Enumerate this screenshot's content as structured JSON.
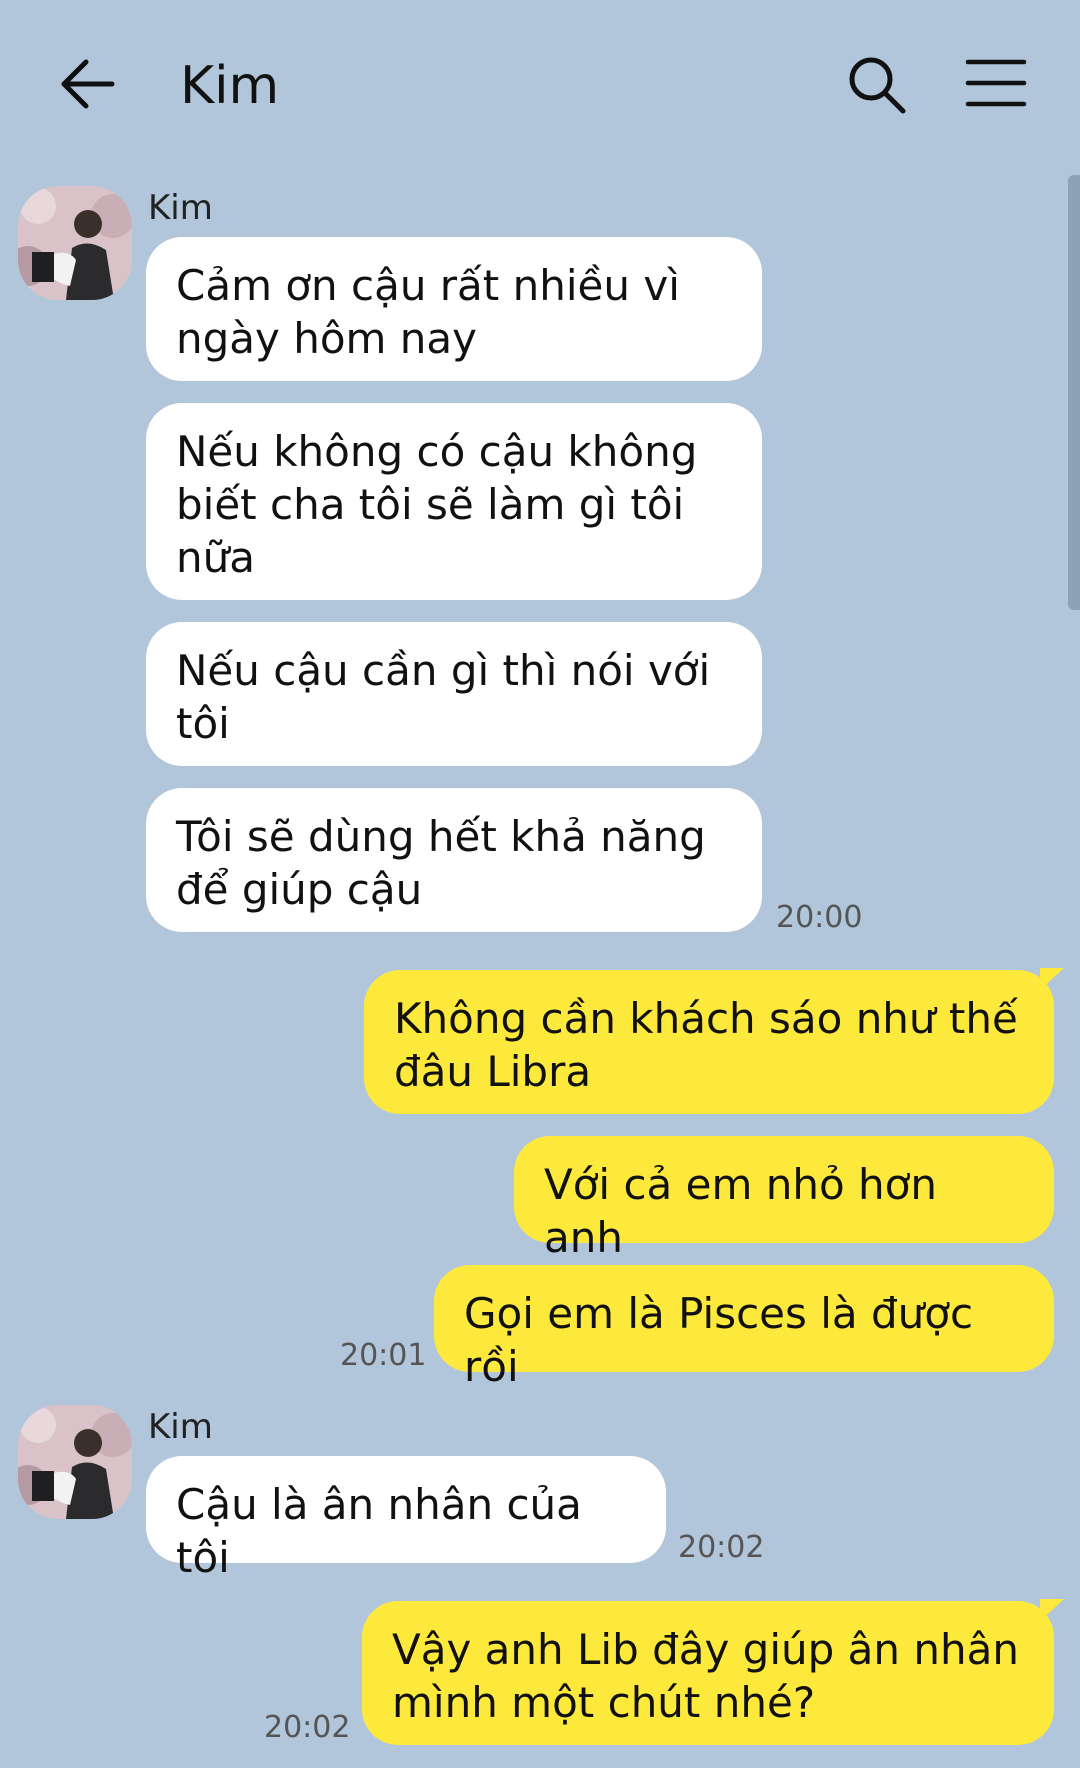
{
  "header": {
    "title": "Kim",
    "back_icon": "arrow-left-icon",
    "search_icon": "search-icon",
    "menu_icon": "hamburger-menu-icon"
  },
  "colors": {
    "background": "#b1c6db",
    "incoming_bubble": "#ffffff",
    "outgoing_bubble": "#fde93c"
  },
  "messages": {
    "group1": {
      "sender": "Kim",
      "m1": "Cảm ơn cậu rất nhiều vì ngày hôm nay",
      "m2": "Nếu không có cậu không biết cha tôi sẽ làm gì tôi nữa",
      "m3": "Nếu cậu cần gì thì nói với tôi",
      "m4": "Tôi sẽ dùng hết khả năng để giúp cậu",
      "time": "20:00"
    },
    "group2": {
      "m1": "Không cần khách sáo như thế đâu Libra",
      "m2": "Với cả em nhỏ hơn anh",
      "m3": "Gọi em là Pisces là được rồi",
      "time": "20:01"
    },
    "group3": {
      "sender": "Kim",
      "m1": "Cậu là ân nhân của tôi",
      "time": "20:02"
    },
    "group4": {
      "m1": "Vậy anh Lib đây giúp ân nhân mình một chút nhé?",
      "time": "20:02"
    }
  }
}
